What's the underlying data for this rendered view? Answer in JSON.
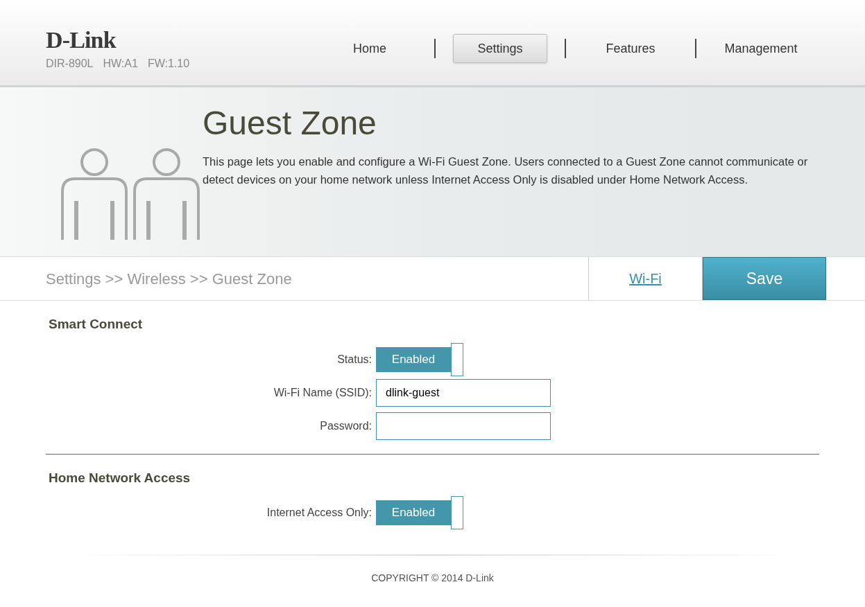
{
  "header": {
    "logo": "D-Link",
    "model": "DIR-890L",
    "hardware": "HW:A1",
    "firmware": "FW:1.10"
  },
  "nav": [
    {
      "label": "Home",
      "selected": false
    },
    {
      "label": "Settings",
      "selected": true
    },
    {
      "label": "Features",
      "selected": false
    },
    {
      "label": "Management",
      "selected": false
    }
  ],
  "banner": {
    "title": "Guest Zone",
    "description": "This page lets you enable and configure a Wi-Fi Guest Zone. Users connected to a Guest Zone cannot communicate or detect devices on your home network unless Internet Access Only is disabled under Home Network Access."
  },
  "breadcrumb": "Settings >> Wireless >> Guest Zone",
  "link": "Wi-Fi",
  "save_button": "Save",
  "sections": [
    {
      "title": "Smart Connect",
      "fields": [
        {
          "kind": "toggle",
          "label": "Status:",
          "on": true,
          "value": "Enabled"
        },
        {
          "kind": "text",
          "label": "Wi-Fi Name (SSID):",
          "value": "dlink-guest"
        },
        {
          "kind": "text",
          "label": "Password:"
        }
      ]
    },
    {
      "title": "Home Network Access",
      "fields": [
        {
          "kind": "toggle",
          "label": "Internet Access Only:",
          "on": true,
          "value": "Enabled"
        }
      ]
    }
  ],
  "footer": "COPYRIGHT © 2014 D-Link"
}
